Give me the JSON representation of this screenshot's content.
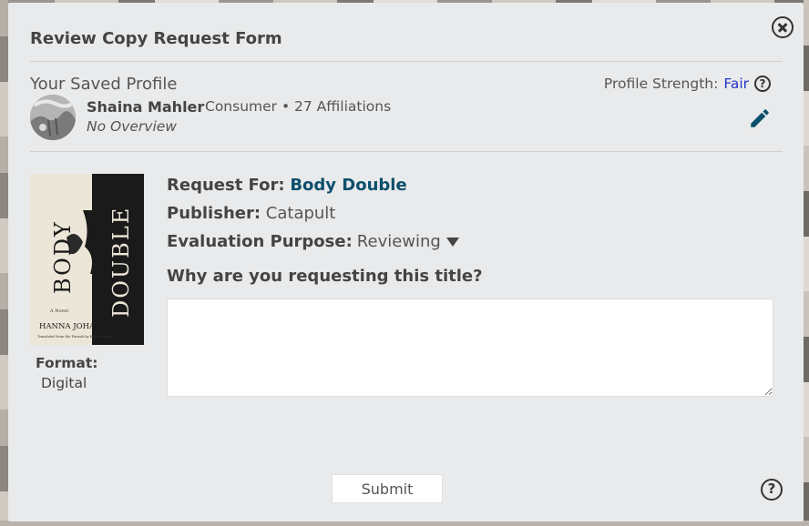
{
  "modal": {
    "title": "Review Copy Request Form"
  },
  "profile": {
    "heading": "Your Saved Profile",
    "strength_label": "Profile Strength:",
    "strength_value": "Fair",
    "name": "Shaina Mahler",
    "meta": "Consumer • 27 Affiliations",
    "overview": "No Overview"
  },
  "book": {
    "cover_title_1": "BODY",
    "cover_title_2": "DOUBLE",
    "cover_subtitle": "A Novel",
    "cover_author": "HANNA JOHANSSON",
    "cover_translator": "Translated from the Finnish by Kira Josefsson",
    "format_label": "Format:",
    "format_value": "Digital"
  },
  "request": {
    "request_for_label": "Request For:",
    "request_for_value": "Body Double",
    "publisher_label": "Publisher:",
    "publisher_value": "Catapult",
    "purpose_label": "Evaluation Purpose:",
    "purpose_value": "Reviewing",
    "question": "Why are you requesting this title?",
    "reason_value": ""
  },
  "footer": {
    "submit_label": "Submit",
    "help_symbol": "?"
  },
  "colors": {
    "accent_link": "#0b4f6c",
    "strength_fair": "#2233cc",
    "edit_icon": "#0b4f6c"
  }
}
